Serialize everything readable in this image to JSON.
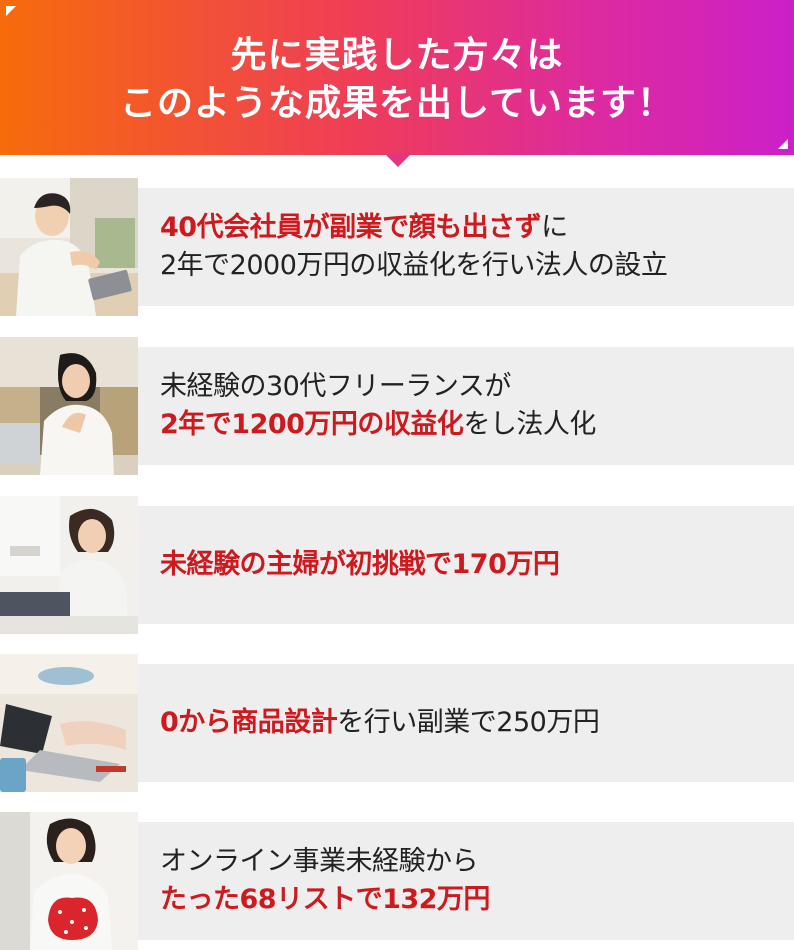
{
  "banner": {
    "title_line1": "先に実践した方々は",
    "title_line2": "このような成果を出しています！",
    "gradient_colors": [
      "#f66c0b",
      "#ef3d58",
      "#dc2aa0",
      "#cc20c8"
    ]
  },
  "highlight_color": "#cc1a1f",
  "results": [
    {
      "photo": "man-working-on-laptop-photo",
      "line1": {
        "highlight": "40代会社員が副業で顔も出さず",
        "normal": "に"
      },
      "line2": {
        "highlight": "",
        "normal": "2年で2000万円の収益化を行い法人の設立"
      }
    },
    {
      "photo": "woman-smiling-at-desk-photo",
      "line1": {
        "highlight": "",
        "normal": "未経験の30代フリーランスが"
      },
      "line2": {
        "highlight": "2年で1200万円の収益化",
        "normal": "をし法人化"
      }
    },
    {
      "photo": "woman-using-laptop-photo",
      "line1": {
        "highlight": "未経験の主婦が初挑戦で170万円",
        "normal": ""
      }
    },
    {
      "photo": "hands-typing-on-laptop-photo",
      "line1": {
        "highlight": "0から商品設計",
        "normal": "を行い副業で250万円"
      }
    },
    {
      "photo": "woman-holding-red-purse-photo",
      "line1": {
        "highlight": "",
        "normal": "オンライン事業未経験から"
      },
      "line2": {
        "highlight": "たった68リストで132万円",
        "normal": ""
      }
    }
  ]
}
